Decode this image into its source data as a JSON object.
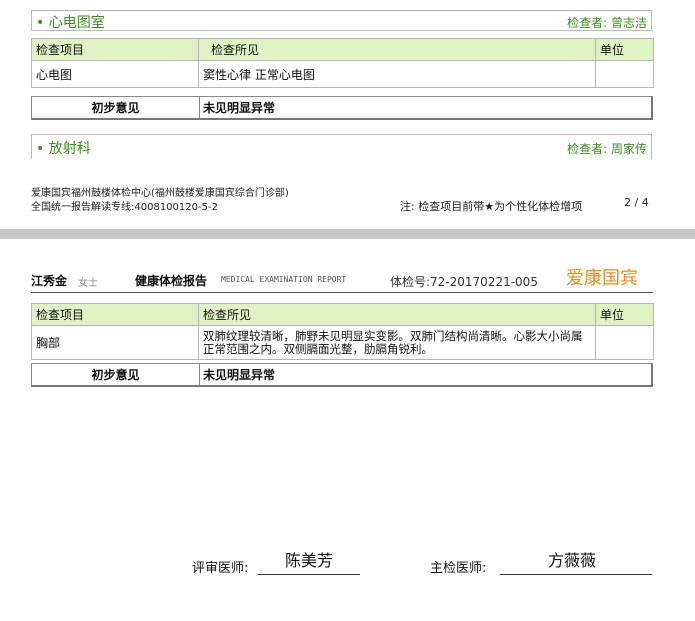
{
  "ecg": {
    "title": "• 心电图室",
    "examiner": "检查者: 曾志洁",
    "headers": [
      "检查项目",
      "检查所见",
      "单位"
    ],
    "row": {
      "item": "心电图",
      "finding": "窦性心律 正常心电图",
      "unit": ""
    },
    "opinion_label": "初步意见",
    "opinion_value": "未见明显异常"
  },
  "radiology": {
    "title": "• 放射科",
    "examiner": "检查者: 周家传",
    "headers": [
      "检查项目",
      "检查所见",
      "单位"
    ],
    "row": {
      "item": "胸部",
      "finding": "双肺纹理较清晰，肺野未见明显实变影。双肺门结构尚清晰。心影大小尚属正常范围之内。双侧膈面光整，肋膈角锐利。",
      "unit": ""
    },
    "opinion_label": "初步意见",
    "opinion_value": "未见明显异常"
  },
  "footer": {
    "org_line": "爱康国宾福州鼓楼体检中心(福州鼓楼爱康国宾综合门诊部)",
    "hotline_line": "全国统一报告解读专线:4008100120-5-2",
    "note": "注: 检查项目前带★为个性化体检增项",
    "page": "2 / 4"
  },
  "header": {
    "patient_name": "江秀金",
    "gender": "女士",
    "report_title": "健康体检报告",
    "report_title_en": "MEDICAL EXAMINATION REPORT",
    "exam_no": "体检号:72-20170221-005",
    "brand": "爱康国宾"
  },
  "signatures": {
    "reviewer_label": "评审医师:",
    "reviewer_name": "陈美芳",
    "chief_label": "主检医师:",
    "chief_name": "方薇薇"
  },
  "colors": {
    "accent_green": "#3d8f1e",
    "header_bg": "#dff2c4",
    "brand_orange": "#f08a1c"
  }
}
